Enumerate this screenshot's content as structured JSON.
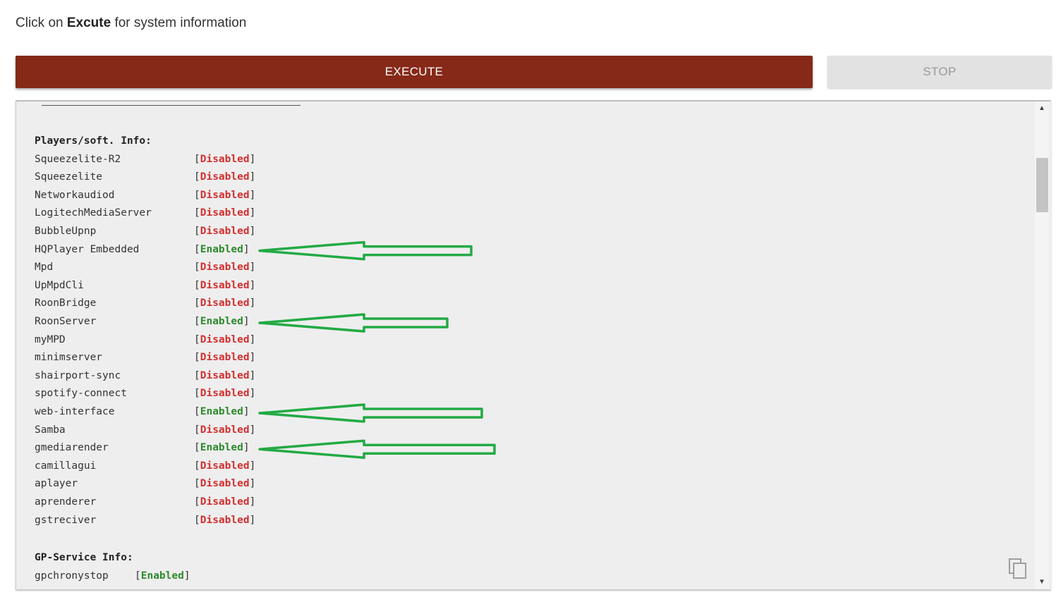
{
  "instruction": {
    "prefix": "Click on ",
    "bold": "Excute",
    "suffix": " for system information"
  },
  "buttons": {
    "execute": "EXECUTE",
    "stop": "STOP"
  },
  "colors": {
    "execute_bg": "#862918",
    "disabled": "#d32f2f",
    "enabled": "#2e8b2e",
    "annotation_arrow": "#22aa44"
  },
  "console": {
    "players_heading": "Players/soft. Info:",
    "players": [
      {
        "name": "Squeezelite-R2",
        "status": "Disabled"
      },
      {
        "name": "Squeezelite",
        "status": "Disabled"
      },
      {
        "name": "Networkaudiod",
        "status": "Disabled"
      },
      {
        "name": "LogitechMediaServer",
        "status": "Disabled"
      },
      {
        "name": "BubbleUpnp",
        "status": "Disabled"
      },
      {
        "name": "HQPlayer Embedded",
        "status": "Enabled"
      },
      {
        "name": "Mpd",
        "status": "Disabled"
      },
      {
        "name": "UpMpdCli",
        "status": "Disabled"
      },
      {
        "name": "RoonBridge",
        "status": "Disabled"
      },
      {
        "name": "RoonServer",
        "status": "Enabled"
      },
      {
        "name": "myMPD",
        "status": "Disabled"
      },
      {
        "name": "minimserver",
        "status": "Disabled"
      },
      {
        "name": "shairport-sync",
        "status": "Disabled"
      },
      {
        "name": "spotify-connect",
        "status": "Disabled"
      },
      {
        "name": "web-interface",
        "status": "Enabled"
      },
      {
        "name": "Samba",
        "status": "Disabled"
      },
      {
        "name": "gmediarender",
        "status": "Enabled"
      },
      {
        "name": "camillagui",
        "status": "Disabled"
      },
      {
        "name": "aplayer",
        "status": "Disabled"
      },
      {
        "name": "aprenderer",
        "status": "Disabled"
      },
      {
        "name": "gstreciver",
        "status": "Disabled"
      }
    ],
    "service_heading": "GP-Service Info:",
    "services": [
      {
        "name": "gpchronystop",
        "status": "Enabled"
      }
    ]
  },
  "icons": {
    "copy": "copy-icon",
    "scroll_up": "scroll-up-arrow-icon",
    "scroll_down": "scroll-down-arrow-icon",
    "annotation": "pointing-arrow-icon"
  }
}
